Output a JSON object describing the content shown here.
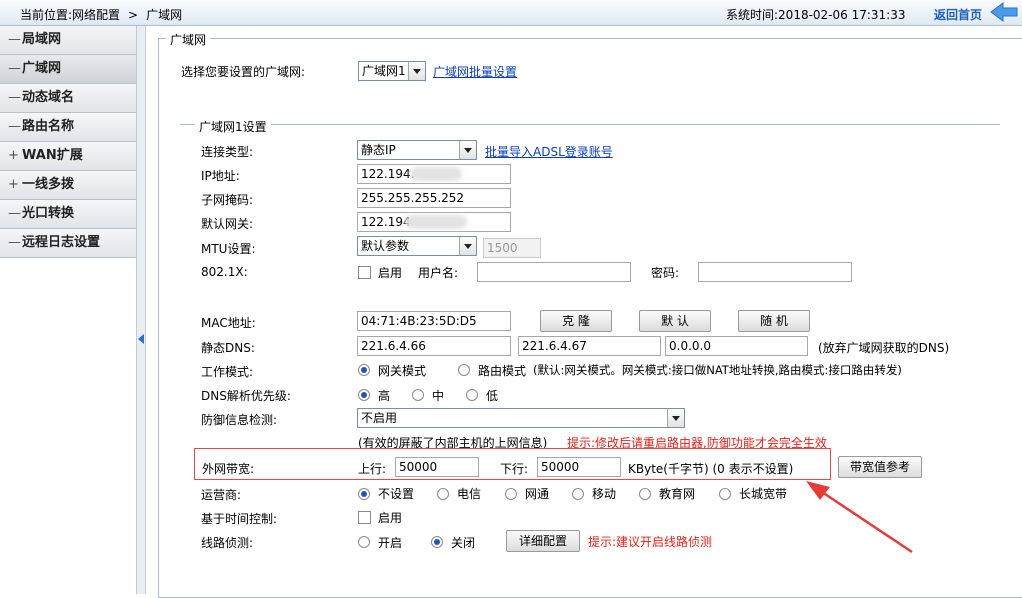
{
  "topbar": {
    "location_label": "当前位置:网络配置",
    "location_sep": ">",
    "location_current": "广域网",
    "system_time": "系统时间:2018-02-06 17:31:33",
    "home_link": "返回首页"
  },
  "sidebar": {
    "items": [
      {
        "prefix": "—",
        "label": "局域网",
        "active": false
      },
      {
        "prefix": "—",
        "label": "广域网",
        "active": true
      },
      {
        "prefix": "—",
        "label": "动态域名",
        "active": false
      },
      {
        "prefix": "—",
        "label": "路由名称",
        "active": false
      },
      {
        "prefix": "+",
        "label": "WAN扩展",
        "active": false
      },
      {
        "prefix": "+",
        "label": "一线多拨",
        "active": false
      },
      {
        "prefix": "—",
        "label": "光口转换",
        "active": false
      },
      {
        "prefix": "—",
        "label": "远程日志设置",
        "active": false
      }
    ]
  },
  "wan_select": {
    "legend": "广域网",
    "prompt": "选择您要设置的广域网:",
    "selected": "广域网1",
    "batch_link": "广域网批量设置"
  },
  "wan1": {
    "legend": "广域网1设置",
    "conn_type_label": "连接类型:",
    "conn_type_value": "静态IP",
    "adsl_link": "批量导入ADSL登录账号",
    "ip_label": "IP地址:",
    "ip_value": "122.194.",
    "mask_label": "子网掩码:",
    "mask_value": "255.255.255.252",
    "gw_label": "默认网关:",
    "gw_value": "122.194",
    "mtu_label": "MTU设置:",
    "mtu_select": "默认参数",
    "mtu_value": "1500",
    "dot1x_label": "802.1X:",
    "dot1x_enable": "启用",
    "username_label": "用户名:",
    "username_value": "",
    "password_label": "密码:",
    "password_value": "",
    "mac_label": "MAC地址:",
    "mac_value": "04:71:4B:23:5D:D5",
    "clone_btn": "克 隆",
    "default_btn": "默 认",
    "random_btn": "随 机",
    "dns_label": "静态DNS:",
    "dns1": "221.6.4.66",
    "dns2": "221.6.4.67",
    "dns3": "0.0.0.0",
    "dns_note": "(放弃广域网获取的DNS)",
    "mode_label": "工作模式:",
    "mode_gateway": "网关模式",
    "mode_router": "路由模式",
    "mode_note": "(默认:网关模式。网关模式:接口做NAT地址转换,路由模式:接口路由转发)",
    "dns_pri_label": "DNS解析优先级:",
    "pri_high": "高",
    "pri_mid": "中",
    "pri_low": "低",
    "defense_label": "防御信息检测:",
    "defense_value": "不启用",
    "defense_note": "(有效的屏蔽了内部主机的上网信息)",
    "defense_tip": "提示:修改后请重启路由器,防御功能才会完全生效",
    "bw_label": "外网带宽:",
    "up_label": "上行:",
    "up_value": "50000",
    "down_label": "下行:",
    "down_value": "50000",
    "bw_unit": "KByte(千字节) (0 表示不设置)",
    "bw_ref_btn": "带宽值参考",
    "isp_label": "运营商:",
    "isp_options": [
      "不设置",
      "电信",
      "网通",
      "移动",
      "教育网",
      "长城宽带"
    ],
    "time_ctrl_label": "基于时间控制:",
    "time_ctrl_enable": "启用",
    "line_detect_label": "线路侦测:",
    "detect_on": "开启",
    "detect_off": "关闭",
    "detail_btn": "详细配置",
    "detect_tip": "提示:建议开启线路侦测"
  },
  "colors": {
    "accent": "#1f57b8",
    "highlight": "#e54a44",
    "tip": "#e0221b"
  }
}
